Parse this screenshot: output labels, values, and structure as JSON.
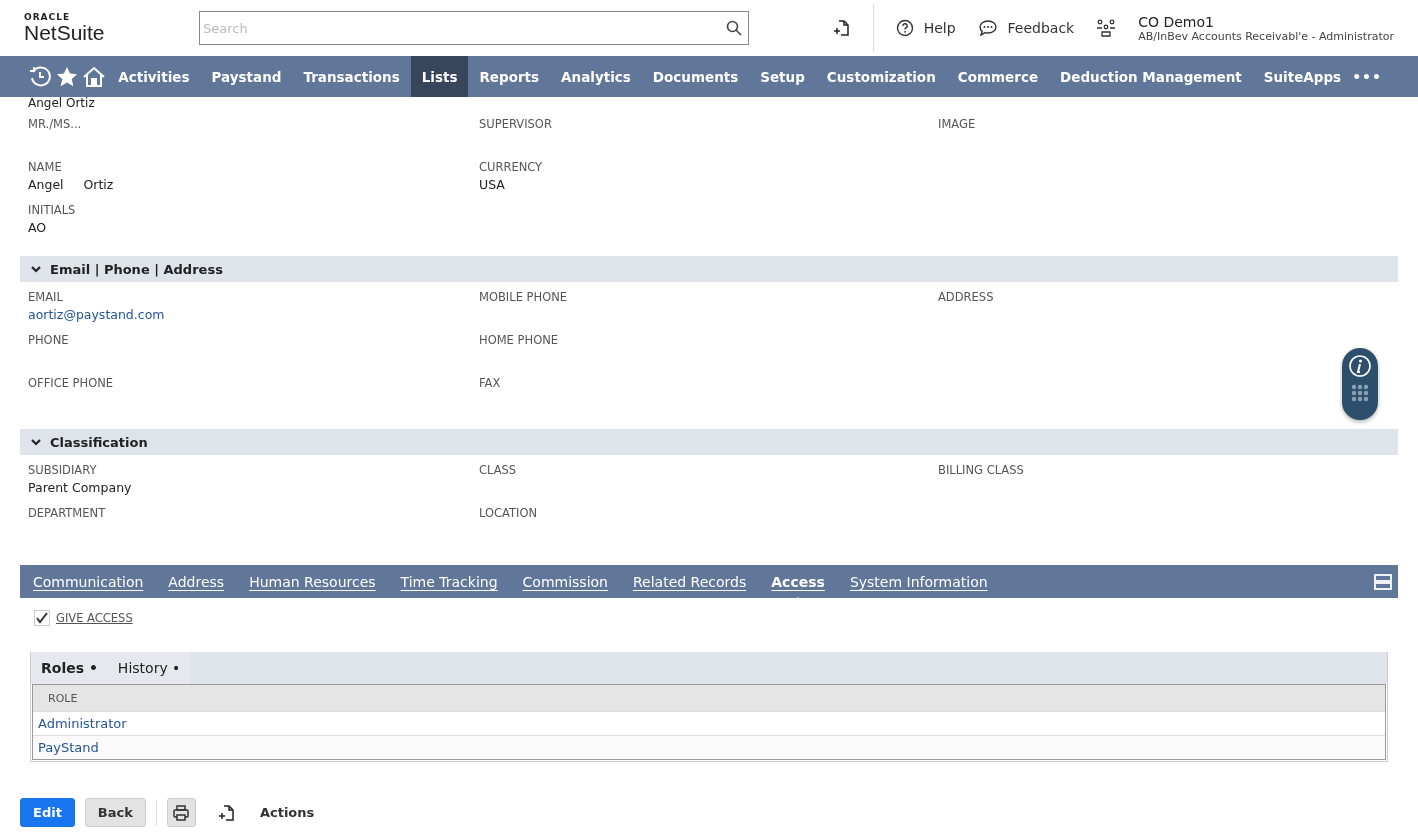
{
  "header": {
    "logo_top": "ORACLE",
    "logo_main": "NetSuite",
    "search": {
      "placeholder": "Search"
    },
    "links": [
      {
        "kind": "help",
        "label": "Help"
      },
      {
        "kind": "feedback",
        "label": "Feedback"
      }
    ],
    "account": {
      "name": "CO Demo1",
      "role": "AB/InBev Accounts Receivabl'e - Administrator"
    }
  },
  "nav": {
    "items": [
      {
        "label": "Activities",
        "selected": false
      },
      {
        "label": "Paystand",
        "selected": false
      },
      {
        "label": "Transactions",
        "selected": false
      },
      {
        "label": "Lists",
        "selected": true
      },
      {
        "label": "Reports",
        "selected": false
      },
      {
        "label": "Analytics",
        "selected": false
      },
      {
        "label": "Documents",
        "selected": false
      },
      {
        "label": "Setup",
        "selected": false
      },
      {
        "label": "Customization",
        "selected": false
      },
      {
        "label": "Commerce",
        "selected": false
      },
      {
        "label": "Deduction Management",
        "selected": false
      },
      {
        "label": "SuiteApps",
        "selected": false
      }
    ],
    "more": "•••"
  },
  "record_title": "Angel Ortiz",
  "primary_fields": [
    [
      {
        "label": "MR./MS..."
      },
      {
        "label": "NAME",
        "value": "Angel     Ortiz"
      },
      {
        "label": "INITIALS",
        "value": "AO"
      }
    ],
    [
      {
        "label": "SUPERVISOR"
      },
      {
        "label": "CURRENCY",
        "value": "USA"
      }
    ],
    [
      {
        "label": "IMAGE"
      }
    ]
  ],
  "sections": [
    {
      "title": "Email | Phone | Address",
      "expanded": true,
      "columns": [
        [
          {
            "label": "EMAIL",
            "value": "aortiz@paystand.com",
            "link": true
          },
          {
            "label": "PHONE"
          },
          {
            "label": "OFFICE PHONE"
          }
        ],
        [
          {
            "label": "MOBILE PHONE"
          },
          {
            "label": "HOME PHONE"
          },
          {
            "label": "FAX"
          }
        ],
        [
          {
            "label": "ADDRESS"
          }
        ]
      ]
    },
    {
      "title": "Classification",
      "expanded": true,
      "columns": [
        [
          {
            "label": "SUBSIDIARY",
            "value": "Parent Company",
            "link": false
          },
          {
            "label": "DEPARTMENT"
          }
        ],
        [
          {
            "label": "CLASS"
          },
          {
            "label": "LOCATION"
          }
        ],
        [
          {
            "label": "BILLING CLASS"
          }
        ]
      ]
    }
  ],
  "subtabs": [
    {
      "label": "Communication",
      "selected": false
    },
    {
      "label": "Address",
      "selected": false
    },
    {
      "label": "Human Resources",
      "selected": false
    },
    {
      "label": "Time Tracking",
      "selected": false
    },
    {
      "label": "Commission",
      "selected": false
    },
    {
      "label": "Related Records",
      "selected": false
    },
    {
      "label": "Access",
      "selected": true
    },
    {
      "label": "System Information",
      "selected": false
    }
  ],
  "give_access": {
    "label": "GIVE ACCESS",
    "checked": true
  },
  "inner_tabs": [
    {
      "label": "Roles •",
      "selected": true
    },
    {
      "label": "History •",
      "selected": false
    }
  ],
  "roles_table": {
    "columns": [
      "ROLE"
    ],
    "rows": [
      [
        "Administrator"
      ],
      [
        "PayStand"
      ]
    ]
  },
  "buttons": [
    {
      "kind": "primary",
      "label": "Edit"
    },
    {
      "kind": "secondary",
      "label": "Back"
    }
  ],
  "actions_label": "Actions"
}
